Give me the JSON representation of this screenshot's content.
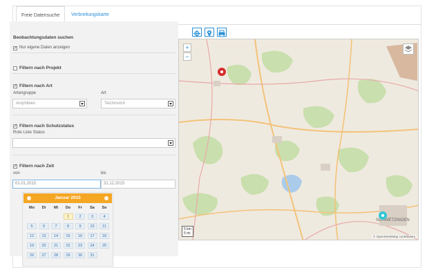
{
  "tabs": [
    {
      "label": "Freie Datensuche"
    },
    {
      "label": "Verbreitungskarte"
    }
  ],
  "sections": {
    "observations": {
      "title": "Beobachtungsdaten suchen",
      "own_data_label": "Nur eigene Daten anzeigen",
      "own_data_checked": true
    },
    "project": {
      "title": "Filtern nach Projekt",
      "checked": false
    },
    "species": {
      "title": "Filtern nach Art",
      "checked": true,
      "group_label": "Artengruppe",
      "group_value": "Amphibien",
      "species_label": "Art",
      "species_value": "Teichmolch"
    },
    "protection": {
      "title": "Filtern nach Schutzstatus",
      "checked": true,
      "red_list_label": "Rote Liste Status",
      "red_list_value": ""
    },
    "time": {
      "title": "Filtern nach Zeit",
      "checked": true,
      "from_label": "von",
      "from_value": "01.01.2015",
      "to_label": "bis",
      "to_value": "31.12.2015"
    }
  },
  "calendar": {
    "title": "Januar 2015",
    "weekdays": [
      "Mo",
      "Di",
      "Mi",
      "Do",
      "Fr",
      "Sa",
      "So"
    ],
    "weeks": [
      [
        "",
        "",
        "",
        "1",
        "2",
        "3",
        "4"
      ],
      [
        "5",
        "6",
        "7",
        "8",
        "9",
        "10",
        "11"
      ],
      [
        "12",
        "13",
        "14",
        "15",
        "16",
        "17",
        "18"
      ],
      [
        "19",
        "20",
        "21",
        "22",
        "23",
        "24",
        "25"
      ],
      [
        "26",
        "27",
        "28",
        "29",
        "30",
        "31",
        ""
      ]
    ],
    "highlighted_day": "1",
    "accent_color": "#f5a623"
  },
  "map": {
    "tool_icons": [
      "crosshair-icon",
      "pin-icon",
      "print-icon"
    ],
    "zoom_in": "+",
    "zoom_out": "−",
    "scale_km": "5 km",
    "scale_mi": "5 mi",
    "attribution": "© OpenStreetMap contributors",
    "city_label": "SCHWETZINGEN"
  },
  "colors": {
    "link": "#2a8fd6",
    "panel": "#f2f2f2",
    "marker_red": "#d62d2d",
    "marker_cyan": "#36c6d3"
  }
}
